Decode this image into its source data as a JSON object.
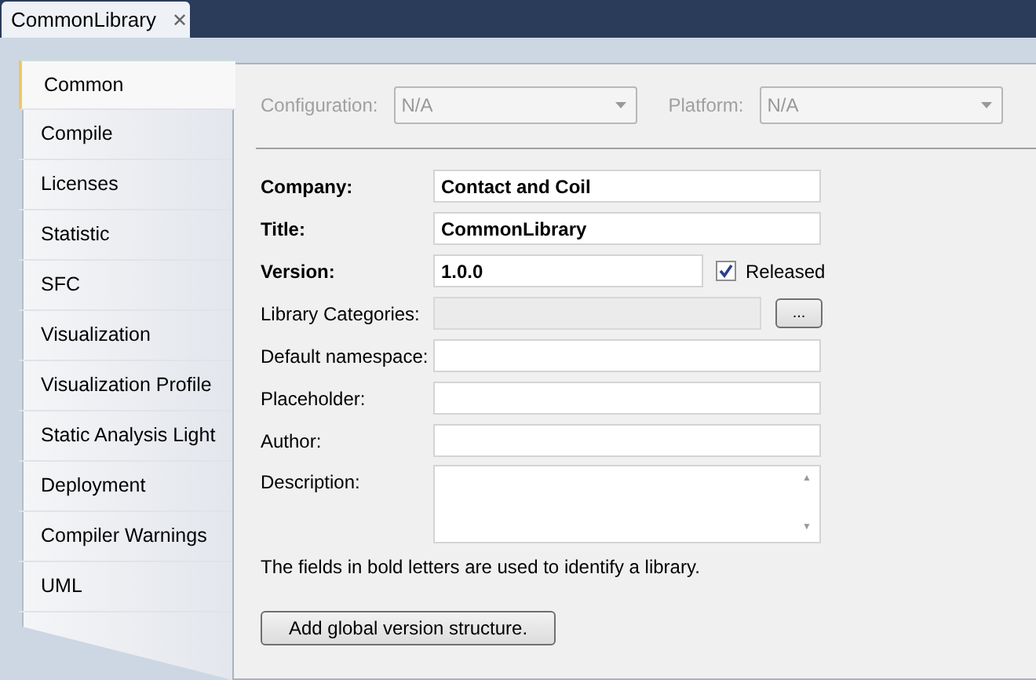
{
  "document_tab": {
    "title": "CommonLibrary",
    "close": "✕"
  },
  "sidebar": {
    "items": [
      {
        "label": "Common",
        "selected": true
      },
      {
        "label": "Compile",
        "selected": false
      },
      {
        "label": "Licenses",
        "selected": false
      },
      {
        "label": "Statistic",
        "selected": false
      },
      {
        "label": "SFC",
        "selected": false
      },
      {
        "label": "Visualization",
        "selected": false
      },
      {
        "label": "Visualization Profile",
        "selected": false
      },
      {
        "label": "Static Analysis Light",
        "selected": false
      },
      {
        "label": "Deployment",
        "selected": false
      },
      {
        "label": "Compiler Warnings",
        "selected": false
      },
      {
        "label": "UML",
        "selected": false
      }
    ]
  },
  "selectors": [
    {
      "label": "Configuration:",
      "value": "N/A",
      "disabled": true
    },
    {
      "label": "Platform:",
      "value": "N/A",
      "disabled": true
    }
  ],
  "fields": [
    {
      "kind": "text",
      "label": "Company:",
      "value": "Contact and Coil",
      "bold": true
    },
    {
      "kind": "text",
      "label": "Title:",
      "value": "CommonLibrary",
      "bold": true
    },
    {
      "kind": "version",
      "label": "Version:",
      "value": "1.0.0",
      "bold": true,
      "checkbox": {
        "label": "Released",
        "checked": true
      }
    },
    {
      "kind": "category",
      "label": "Library Categories:",
      "bold": false,
      "button": "..."
    },
    {
      "kind": "text",
      "label": "Default namespace:",
      "bold": false
    },
    {
      "kind": "text",
      "label": "Placeholder:",
      "bold": false
    },
    {
      "kind": "text",
      "label": "Author:",
      "bold": false
    },
    {
      "kind": "description",
      "label": "Description:",
      "bold": false,
      "scroll_up": "▲",
      "scroll_down": "▼"
    }
  ],
  "note": "The fields in bold letters are used to identify a library.",
  "action_button": "Add global version structure."
}
